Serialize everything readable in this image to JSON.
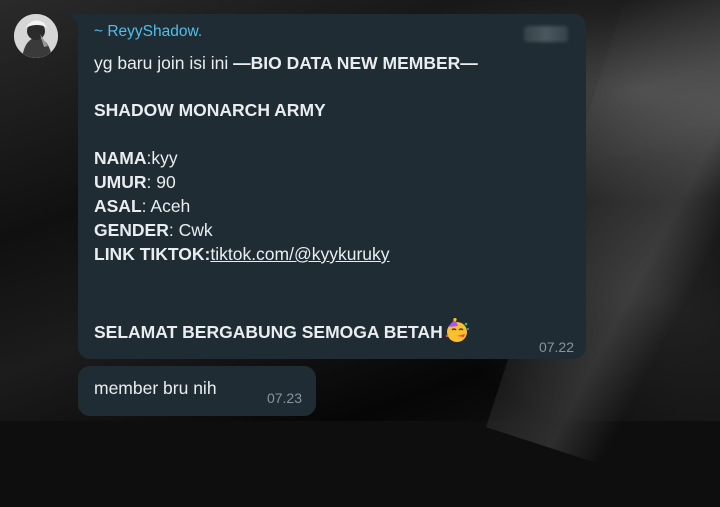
{
  "message1": {
    "sender": "~ ReyyShadow.",
    "line1_prefix": "yg baru join isi ini ",
    "line1_bold": "—BIO DATA NEW MEMBER—",
    "heading": "SHADOW MONARCH ARMY",
    "fields": {
      "nama_label": "NAMA",
      "nama_value": ":kyy",
      "umur_label": "UMUR",
      "umur_value": ": 90",
      "asal_label": "ASAL",
      "asal_value": ": Aceh",
      "gender_label": "GENDER",
      "gender_value": ": Cwk",
      "tiktok_label": "LINK TIKTOK",
      "tiktok_colon": ":",
      "tiktok_link": "tiktok.com/@kyykuruky"
    },
    "closing": "SELAMAT BERGABUNG SEMOGA BETAH",
    "closing_emoji": "partying-face-icon",
    "time": "07.22"
  },
  "message2": {
    "text": "member bru nih",
    "time": "07.23"
  },
  "colors": {
    "bubble": "#1f2c33",
    "sender": "#53bdeb",
    "text": "#e9edef",
    "time": "#8696a0"
  }
}
